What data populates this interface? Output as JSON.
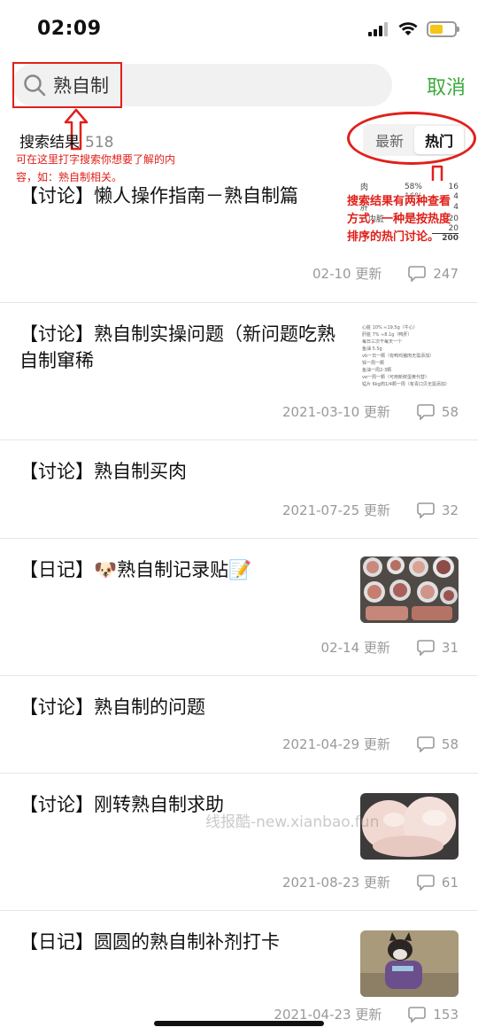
{
  "status_bar": {
    "time": "02:09"
  },
  "search": {
    "query": "熟自制",
    "cancel_label": "取消"
  },
  "results": {
    "label": "搜索结果",
    "count": "518"
  },
  "sort": {
    "newest_label": "最新",
    "hot_label": "热门",
    "active": "hot"
  },
  "annotations": {
    "search_hint": "可在这里打字搜索你想要了解的内容，如：熟自制相关。",
    "sort_hint": "搜索结果有两种查看方式，一种是按热度排序的热门讨论。"
  },
  "posts": [
    {
      "title": "【讨论】懒人操作指南－熟自制篇",
      "date": "02-10 更新",
      "comments": "247",
      "thumb": "table"
    },
    {
      "title": "【讨论】熟自制实操问题（新问题吃熟自制窜稀",
      "date": "2021-03-10 更新",
      "comments": "58",
      "thumb": "text"
    },
    {
      "title": "【讨论】熟自制买肉",
      "date": "2021-07-25 更新",
      "comments": "32",
      "thumb": ""
    },
    {
      "title": "【日记】🐶熟自制记录贴📝",
      "date": "02-14 更新",
      "comments": "31",
      "thumb": "meat-bowls"
    },
    {
      "title": "【讨论】熟自制的问题",
      "date": "2021-04-29 更新",
      "comments": "58",
      "thumb": ""
    },
    {
      "title": "【讨论】刚转熟自制求助",
      "date": "2021-08-23 更新",
      "comments": "61",
      "thumb": "chicken"
    },
    {
      "title": "【日记】圆圆的熟自制补剂打卡",
      "date": "2021-04-23 更新",
      "comments": "153",
      "thumb": "dog"
    }
  ],
  "thumb_table": {
    "rows": [
      [
        "肉",
        "58%",
        "16"
      ],
      [
        "",
        "16%",
        "4"
      ],
      [
        "肝",
        "",
        "4"
      ],
      [
        "它内脏",
        "5%",
        "20"
      ],
      [
        "",
        "",
        "20"
      ],
      [
        "",
        "",
        "200"
      ]
    ]
  },
  "thumb_text_lines": [
    "心脏 10% ≈19.5g（牛心）",
    "肝脏 7% ≈8.1g（鸭肝）",
    "每日三次干每天一个",
    "鱼油 5.5g",
    "vb一日一颗（有鸭鸡猪肉无需添加）",
    "锌一周一颗",
    "鱼油一周2-3颗",
    "ve一周一颗（可用新鲜蛋黄代替）",
    "锰片 6kg肉1/4颗一周（有青口贝无需添加）"
  ],
  "watermark": "线报酷-new.xianbao.fun",
  "colors": {
    "accent_green": "#3caa3c",
    "annotation_red": "#e0201a",
    "battery_yellow": "#f5c518"
  }
}
